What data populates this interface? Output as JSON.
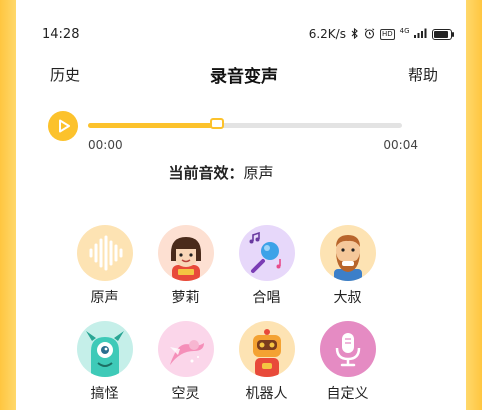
{
  "status_bar": {
    "time": "14:28",
    "network_speed": "6.2K/s",
    "icons": [
      "bluetooth-icon",
      "alarm-icon",
      "hd-icon",
      "signal-4g-icon",
      "battery-icon"
    ],
    "hd_text": "HD",
    "net_text": "4G"
  },
  "header": {
    "left_label": "历史",
    "title": "录音变声",
    "right_label": "帮助"
  },
  "player": {
    "progress_fraction": 0.41,
    "current_time": "00:00",
    "total_time": "00:04",
    "accent_color": "#fcc22c"
  },
  "current_effect": {
    "label": "当前音效：",
    "value": "原声"
  },
  "effects": [
    {
      "label": "原声",
      "icon": "waveform-icon",
      "bg": "#fde3b3"
    },
    {
      "label": "萝莉",
      "icon": "girl-avatar-icon",
      "bg": "#fde0d2"
    },
    {
      "label": "合唱",
      "icon": "microphone-notes-icon",
      "bg": "#e7d8fa"
    },
    {
      "label": "大叔",
      "icon": "bearded-man-icon",
      "bg": "#fde3b3"
    },
    {
      "label": "搞怪",
      "icon": "monster-icon",
      "bg": "#c5efe9"
    },
    {
      "label": "空灵",
      "icon": "fairy-icon",
      "bg": "#fbd6ea"
    },
    {
      "label": "机器人",
      "icon": "robot-icon",
      "bg": "#fde3b3"
    },
    {
      "label": "自定义",
      "icon": "custom-mic-icon",
      "bg": "#e58bc3"
    }
  ]
}
